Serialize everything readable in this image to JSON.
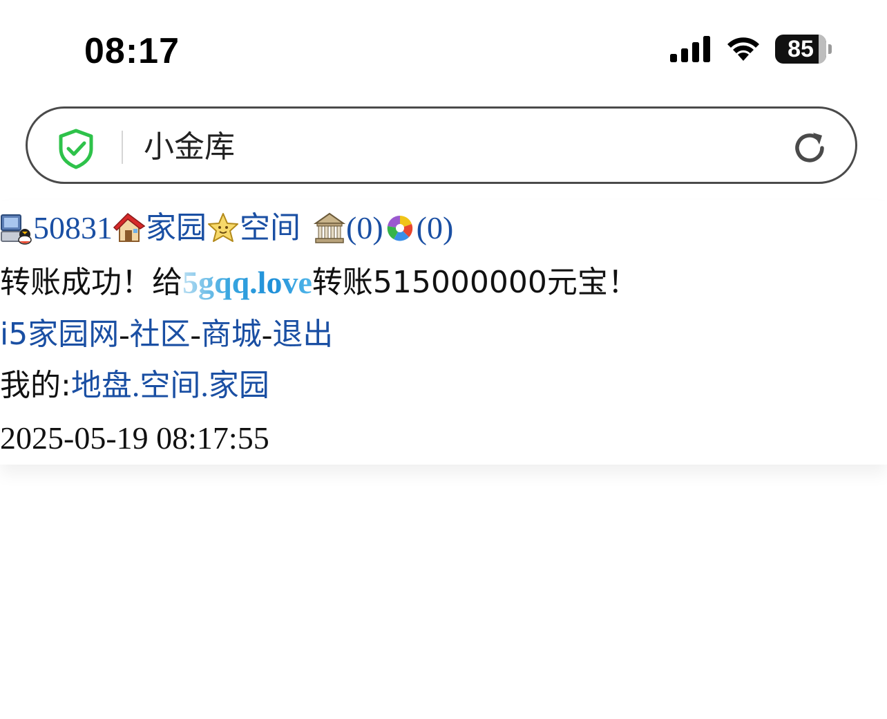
{
  "status_bar": {
    "time": "08:17",
    "battery_level": "85",
    "battery_percent": 85,
    "signal_bars": 4,
    "icons": [
      "signal-icon",
      "wifi-icon",
      "battery-icon"
    ]
  },
  "address_bar": {
    "title": "小金库",
    "icons": [
      "shield-icon",
      "reload-icon"
    ],
    "shield_color": "#2ec24a"
  },
  "nav_line": {
    "user_id": "50831",
    "home_label": "家园",
    "space_label": "空间",
    "bank_count": "(0)",
    "photo_count": "(0)",
    "icons": [
      "computer-user-icon",
      "house-icon",
      "star-icon",
      "bank-icon",
      "colorful-ball-icon"
    ]
  },
  "message": {
    "prefix": "转账成功！给",
    "recipient": "5gqq.love",
    "suffix": "转账515000000元宝！"
  },
  "links_line": {
    "site": "i5家园网",
    "sep1": "-",
    "community": "社区",
    "sep2": "-",
    "mall": "商城",
    "sep3": "-",
    "logout": "退出"
  },
  "my_line": {
    "label": "我的:",
    "land": "地盘",
    "dot1": ".",
    "space": "空间",
    "dot2": ".",
    "home": "家园"
  },
  "timestamp": "2025-05-19 08:17:55",
  "colors": {
    "link": "#1a4fa3",
    "text": "#111111",
    "recipient_gradient": "#1e8fd8"
  }
}
